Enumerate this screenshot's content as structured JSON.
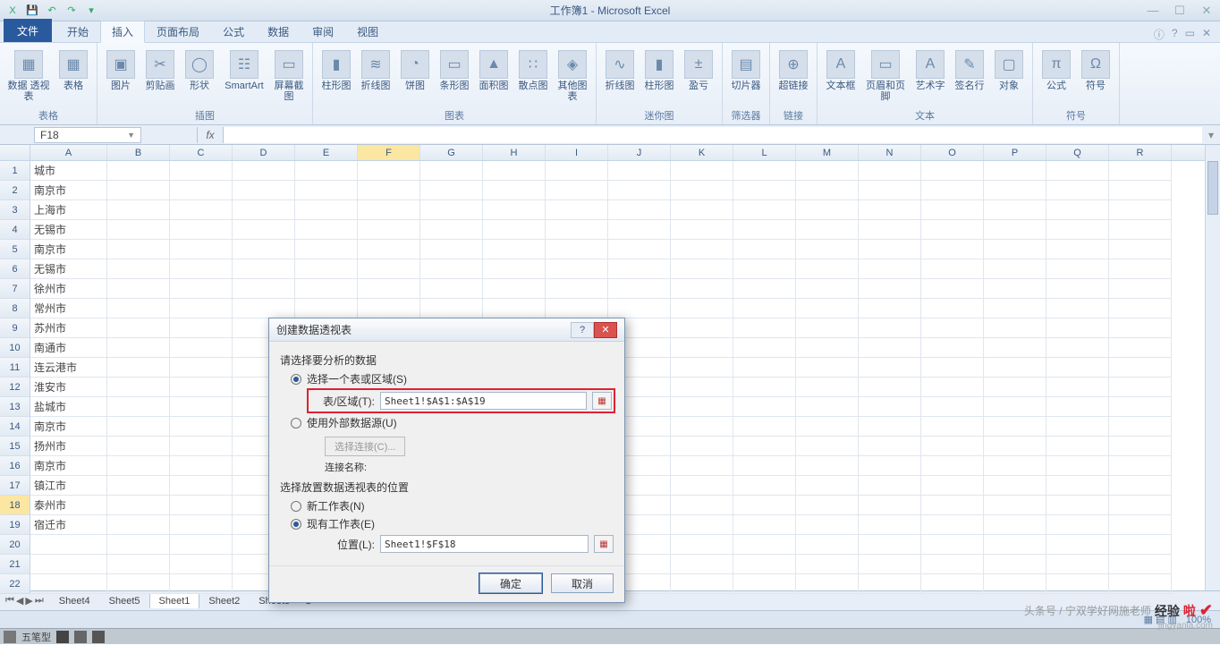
{
  "title": "工作簿1 - Microsoft Excel",
  "qat": {
    "undo_tip": "↶",
    "redo_tip": "↷"
  },
  "win": {
    "min": "—",
    "max": "☐",
    "close": "✕"
  },
  "tabs": {
    "file": "文件",
    "items": [
      "开始",
      "插入",
      "页面布局",
      "公式",
      "数据",
      "审阅",
      "视图"
    ],
    "active_index": 1,
    "help_icons": [
      "ⓘ",
      "?",
      "▭",
      "✕"
    ]
  },
  "ribbon": {
    "groups": [
      {
        "label": "表格",
        "items": [
          {
            "l": "数据\n透视表",
            "i": "▦"
          },
          {
            "l": "表格",
            "i": "▦"
          }
        ]
      },
      {
        "label": "插图",
        "items": [
          {
            "l": "图片",
            "i": "▣"
          },
          {
            "l": "剪贴画",
            "i": "✂"
          },
          {
            "l": "形状",
            "i": "◯"
          },
          {
            "l": "SmartArt",
            "i": "☷"
          },
          {
            "l": "屏幕截图",
            "i": "▭"
          }
        ]
      },
      {
        "label": "图表",
        "items": [
          {
            "l": "柱形图",
            "i": "▮"
          },
          {
            "l": "折线图",
            "i": "≋"
          },
          {
            "l": "饼图",
            "i": "◔"
          },
          {
            "l": "条形图",
            "i": "▭"
          },
          {
            "l": "面积图",
            "i": "▲"
          },
          {
            "l": "散点图",
            "i": "∷"
          },
          {
            "l": "其他图表",
            "i": "◈"
          }
        ]
      },
      {
        "label": "迷你图",
        "items": [
          {
            "l": "折线图",
            "i": "∿"
          },
          {
            "l": "柱形图",
            "i": "▮"
          },
          {
            "l": "盈亏",
            "i": "±"
          }
        ]
      },
      {
        "label": "筛选器",
        "items": [
          {
            "l": "切片器",
            "i": "▤"
          }
        ]
      },
      {
        "label": "链接",
        "items": [
          {
            "l": "超链接",
            "i": "⊕"
          }
        ]
      },
      {
        "label": "文本",
        "items": [
          {
            "l": "文本框",
            "i": "A"
          },
          {
            "l": "页眉和页脚",
            "i": "▭"
          },
          {
            "l": "艺术字",
            "i": "A"
          },
          {
            "l": "签名行",
            "i": "✎"
          },
          {
            "l": "对象",
            "i": "▢"
          }
        ]
      },
      {
        "label": "符号",
        "items": [
          {
            "l": "公式",
            "i": "π"
          },
          {
            "l": "符号",
            "i": "Ω"
          }
        ]
      }
    ]
  },
  "namebox": "F18",
  "fx": "fx",
  "columns": [
    "A",
    "B",
    "C",
    "D",
    "E",
    "F",
    "G",
    "H",
    "I",
    "J",
    "K",
    "L",
    "M",
    "N",
    "O",
    "P",
    "Q",
    "R"
  ],
  "sel_col": "F",
  "sel_row": 18,
  "rows": [
    {
      "n": 1,
      "a": "城市"
    },
    {
      "n": 2,
      "a": "南京市"
    },
    {
      "n": 3,
      "a": "上海市"
    },
    {
      "n": 4,
      "a": "无锡市"
    },
    {
      "n": 5,
      "a": "南京市"
    },
    {
      "n": 6,
      "a": "无锡市"
    },
    {
      "n": 7,
      "a": "徐州市"
    },
    {
      "n": 8,
      "a": "常州市"
    },
    {
      "n": 9,
      "a": "苏州市"
    },
    {
      "n": 10,
      "a": "南通市"
    },
    {
      "n": 11,
      "a": "连云港市"
    },
    {
      "n": 12,
      "a": "淮安市"
    },
    {
      "n": 13,
      "a": "盐城市"
    },
    {
      "n": 14,
      "a": "南京市"
    },
    {
      "n": 15,
      "a": "扬州市"
    },
    {
      "n": 16,
      "a": "南京市"
    },
    {
      "n": 17,
      "a": "镇江市"
    },
    {
      "n": 18,
      "a": "泰州市"
    },
    {
      "n": 19,
      "a": "宿迁市"
    },
    {
      "n": 20,
      "a": ""
    },
    {
      "n": 21,
      "a": ""
    },
    {
      "n": 22,
      "a": ""
    }
  ],
  "sheets": [
    "Sheet4",
    "Sheet5",
    "Sheet1",
    "Sheet2",
    "Sheet3"
  ],
  "active_sheet": "Sheet1",
  "dialog": {
    "title": "创建数据透视表",
    "section1": "请选择要分析的数据",
    "opt_range": "选择一个表或区域(S)",
    "range_label": "表/区域(T):",
    "range_value": "Sheet1!$A$1:$A$19",
    "opt_ext": "使用外部数据源(U)",
    "choose_conn": "选择连接(C)...",
    "conn_name": "连接名称:",
    "section2": "选择放置数据透视表的位置",
    "opt_new": "新工作表(N)",
    "opt_exist": "现有工作表(E)",
    "loc_label": "位置(L):",
    "loc_value": "Sheet1!$F$18",
    "ok": "确定",
    "cancel": "取消"
  },
  "status": {
    "zoom": "100%",
    "views": "▦ ▤ ▥"
  },
  "taskbar": {
    "ime": "五笔型"
  },
  "watermark": {
    "pre": "头条号 / 宁双学好网施老师",
    "j": "经验",
    "l": "啦",
    "sub": "jingyanla.com"
  }
}
